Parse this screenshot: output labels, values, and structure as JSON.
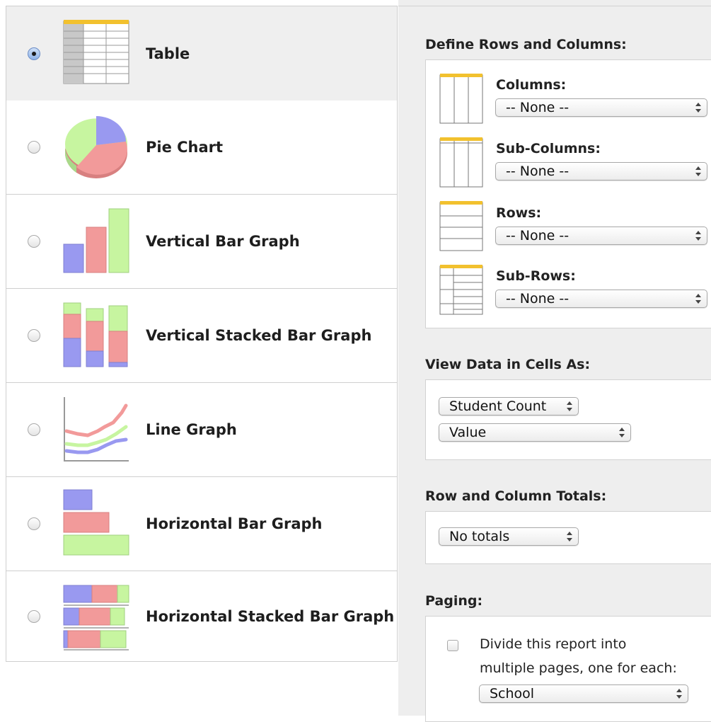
{
  "chart_types": [
    {
      "label": "Table",
      "icon": "table-icon",
      "selected": true
    },
    {
      "label": "Pie Chart",
      "icon": "pie-chart-icon",
      "selected": false
    },
    {
      "label": "Vertical Bar Graph",
      "icon": "vertical-bar-graph-icon",
      "selected": false
    },
    {
      "label": "Vertical Stacked Bar Graph",
      "icon": "vertical-stacked-bar-graph-icon",
      "selected": false
    },
    {
      "label": "Line Graph",
      "icon": "line-graph-icon",
      "selected": false
    },
    {
      "label": "Horizontal Bar Graph",
      "icon": "horizontal-bar-graph-icon",
      "selected": false
    },
    {
      "label": "Horizontal Stacked Bar Graph",
      "icon": "horizontal-stacked-bar-graph-icon",
      "selected": false
    }
  ],
  "define": {
    "title": "Define Rows and Columns:",
    "items": [
      {
        "label": "Columns:",
        "value": "-- None --",
        "icon": "columns-icon"
      },
      {
        "label": "Sub-Columns:",
        "value": "-- None --",
        "icon": "sub-columns-icon"
      },
      {
        "label": "Rows:",
        "value": "-- None --",
        "icon": "rows-icon"
      },
      {
        "label": "Sub-Rows:",
        "value": "-- None --",
        "icon": "sub-rows-icon"
      }
    ]
  },
  "view": {
    "title": "View Data in Cells As:",
    "measure": "Student Count",
    "format": "Value"
  },
  "totals": {
    "title": "Row and Column Totals:",
    "value": "No totals"
  },
  "paging": {
    "title": "Paging:",
    "checkbox_checked": false,
    "line1": "Divide this report into",
    "line2": "multiple pages, one for each:",
    "value": "School"
  },
  "colors": {
    "blue": "#9999f0",
    "red": "#f29a9a",
    "green": "#c7f5a0",
    "gold": "#f2c12e",
    "panel_bg": "#eeeeee"
  }
}
